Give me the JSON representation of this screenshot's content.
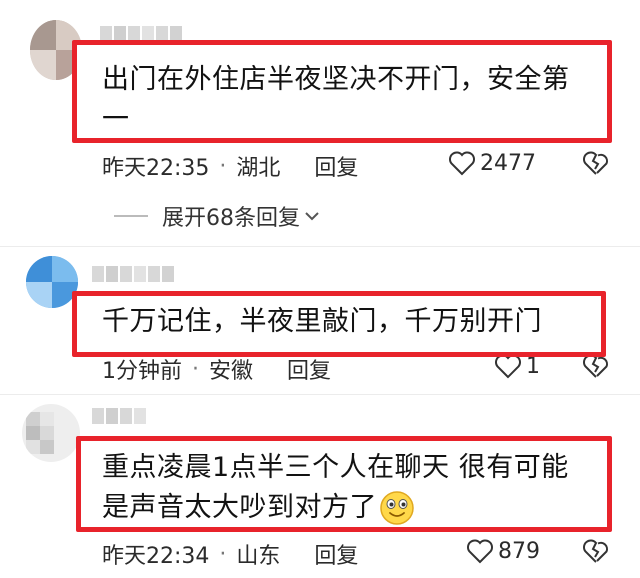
{
  "comments": [
    {
      "text_line1": "出门在外住店半夜坚决不开门，安全第",
      "text_line2": "一",
      "time": "昨天22:35",
      "location": "湖北",
      "reply": "回复",
      "likes": "2477",
      "expand": "展开68条回复"
    },
    {
      "text_line1": "千万记住，半夜里敲门，千万别开门",
      "time": "1分钟前",
      "location": "安徽",
      "reply": "回复",
      "likes": "1"
    },
    {
      "text_line1": "重点凌晨1点半三个人在聊天  很有可能",
      "text_line2": "是声音太大吵到对方了",
      "time": "昨天22:34",
      "location": "山东",
      "reply": "回复",
      "likes": "879"
    }
  ],
  "colors": {
    "highlight_box": "#e8232b",
    "text": "#121212",
    "meta": "#2b2b2b"
  },
  "icons": {
    "like": "heart-outline-icon",
    "dislike": "broken-heart-icon",
    "emoji": "grinning-face-emoji",
    "expand": "chevron-down-icon"
  },
  "separator": "·"
}
